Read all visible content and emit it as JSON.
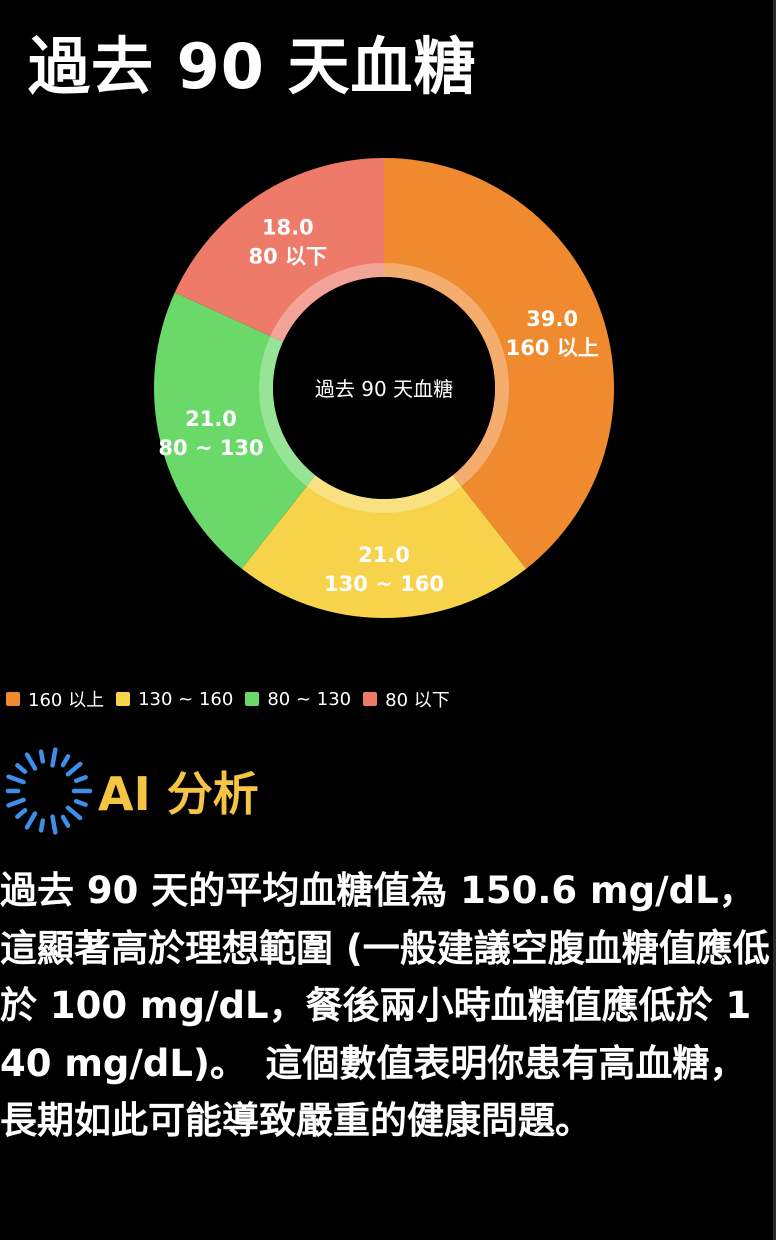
{
  "page": {
    "title": "過去 90 天血糖"
  },
  "chart_data": {
    "type": "pie",
    "variant": "donut",
    "center_label": "過去 90 天血糖",
    "categories": [
      "160 以上",
      "130 ~ 160",
      "80 ~ 130",
      "80 以下"
    ],
    "values": [
      39.0,
      21.0,
      21.0,
      18.0
    ],
    "value_labels": [
      "39.0",
      "21.0",
      "21.0",
      "18.0"
    ],
    "colors": [
      "#ef8a2e",
      "#f6d34b",
      "#6bd96a",
      "#ee7b6a"
    ],
    "legend_position": "bottom-left"
  },
  "legend": {
    "items": [
      {
        "label": "160 以上",
        "color": "#ef8a2e"
      },
      {
        "label": "130 ~ 160",
        "color": "#f6d34b"
      },
      {
        "label": "80 ~ 130",
        "color": "#6bd96a"
      },
      {
        "label": "80 以下",
        "color": "#ee7b6a"
      }
    ]
  },
  "ai": {
    "icon": "ai-spark-icon",
    "title": "AI 分析",
    "title_color": "#f4c542",
    "icon_color": "#3d8fe8",
    "analysis": "過去 90 天的平均血糖值為 150.6 mg/dL，這顯著高於理想範圍 (一般建議空腹血糖值應低於 100 mg/dL，餐後兩小時血糖值應低於 140 mg/dL)。　這個數值表明你患有高血糖，長期如此可能導致嚴重的健康問題。"
  }
}
